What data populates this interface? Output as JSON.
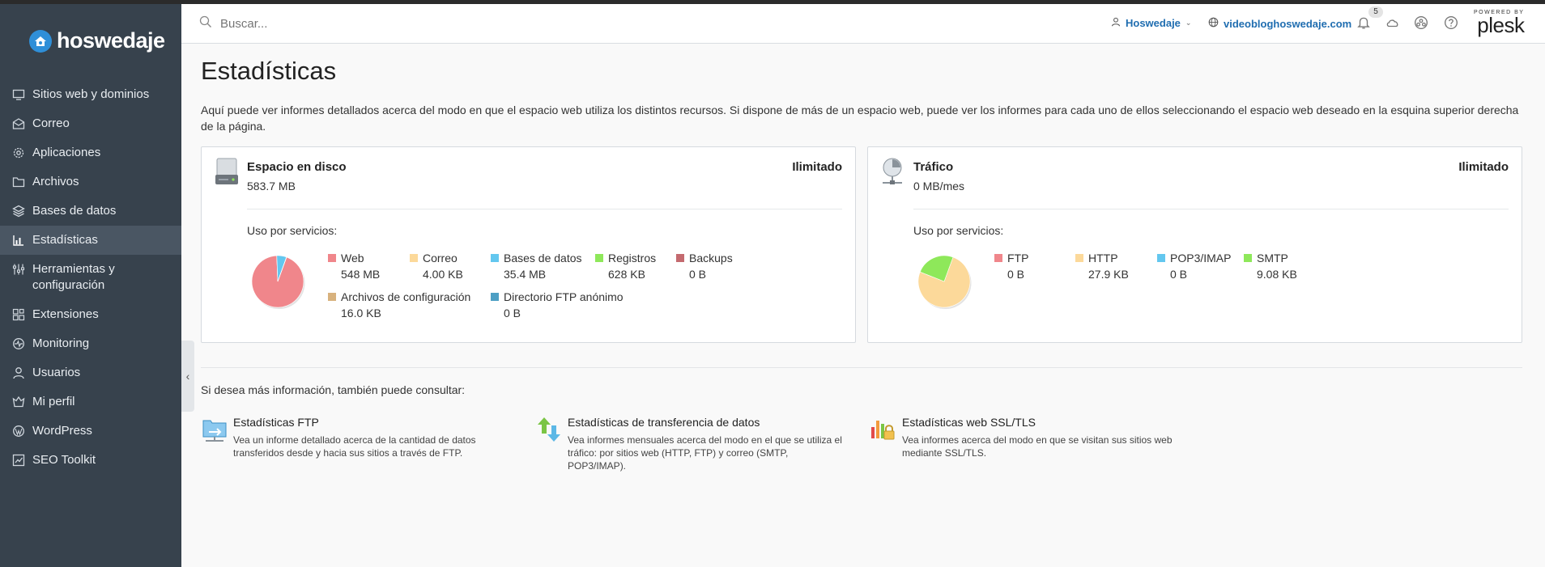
{
  "brand": {
    "name": "hoswedaje"
  },
  "sidebar": {
    "items": [
      {
        "label": "Sitios web y dominios",
        "icon": "monitor-icon"
      },
      {
        "label": "Correo",
        "icon": "mail-icon"
      },
      {
        "label": "Aplicaciones",
        "icon": "gear-icon"
      },
      {
        "label": "Archivos",
        "icon": "folder-icon"
      },
      {
        "label": "Bases de datos",
        "icon": "database-icon"
      },
      {
        "label": "Estadísticas",
        "icon": "bar-chart-icon",
        "active": true
      },
      {
        "label": "Herramientas y configuración",
        "icon": "tools-icon"
      },
      {
        "label": "Extensiones",
        "icon": "extensions-icon"
      },
      {
        "label": "Monitoring",
        "icon": "monitoring-icon"
      },
      {
        "label": "Usuarios",
        "icon": "user-icon"
      },
      {
        "label": "Mi perfil",
        "icon": "profile-icon"
      },
      {
        "label": "WordPress",
        "icon": "wordpress-icon"
      },
      {
        "label": "SEO Toolkit",
        "icon": "seo-icon"
      }
    ]
  },
  "header": {
    "search_placeholder": "Buscar...",
    "user": "Hoswedaje",
    "domain": "videobloghoswedaje.com",
    "notifications_count": "5",
    "powered_by": "POWERED BY",
    "plesk": "plesk"
  },
  "main": {
    "title": "Estadísticas",
    "intro": "Aquí puede ver informes detallados acerca del modo en que el espacio web utiliza los distintos recursos. Si dispone de más de un espacio web, puede ver los informes para cada uno de ellos seleccionando el espacio web deseado en la esquina superior derecha de la página.",
    "uso_label": "Uso por servicios:",
    "disk": {
      "title": "Espacio en disco",
      "value": "583.7 MB",
      "limit": "Ilimitado",
      "legend": [
        {
          "label": "Web",
          "value": "548 MB",
          "color": "#f0868b"
        },
        {
          "label": "Correo",
          "value": "4.00 KB",
          "color": "#fcd99a"
        },
        {
          "label": "Bases de datos",
          "value": "35.4 MB",
          "color": "#63c7ef"
        },
        {
          "label": "Registros",
          "value": "628 KB",
          "color": "#8ee85a"
        },
        {
          "label": "Backups",
          "value": "0 B",
          "color": "#c46a6f"
        },
        {
          "label": "Archivos de configuración",
          "value": "16.0 KB",
          "color": "#d8b27e"
        },
        {
          "label": "Directorio FTP anónimo",
          "value": "0 B",
          "color": "#4d9fc4"
        }
      ]
    },
    "traffic": {
      "title": "Tráfico",
      "value": "0 MB/mes",
      "limit": "Ilimitado",
      "legend": [
        {
          "label": "FTP",
          "value": "0 B",
          "color": "#f0868b"
        },
        {
          "label": "HTTP",
          "value": "27.9 KB",
          "color": "#fcd99a"
        },
        {
          "label": "POP3/IMAP",
          "value": "0 B",
          "color": "#63c7ef"
        },
        {
          "label": "SMTP",
          "value": "9.08 KB",
          "color": "#8ee85a"
        }
      ]
    },
    "more_info": "Si desea más información, también puede consultar:",
    "links": [
      {
        "title": "Estadísticas FTP",
        "desc": "Vea un informe detallado acerca de la cantidad de datos transferidos desde y hacia sus sitios a través de FTP.",
        "icon": "ftp-stats-icon"
      },
      {
        "title": "Estadísticas de transferencia de datos",
        "desc": "Vea informes mensuales acerca del modo en el que se utiliza el tráfico: por sitios web (HTTP, FTP) y correo (SMTP, POP3/IMAP).",
        "icon": "transfer-stats-icon"
      },
      {
        "title": "Estadísticas web SSL/TLS",
        "desc": "Vea informes acerca del modo en que se visitan sus sitios web mediante SSL/TLS.",
        "icon": "ssl-stats-icon"
      }
    ]
  }
}
